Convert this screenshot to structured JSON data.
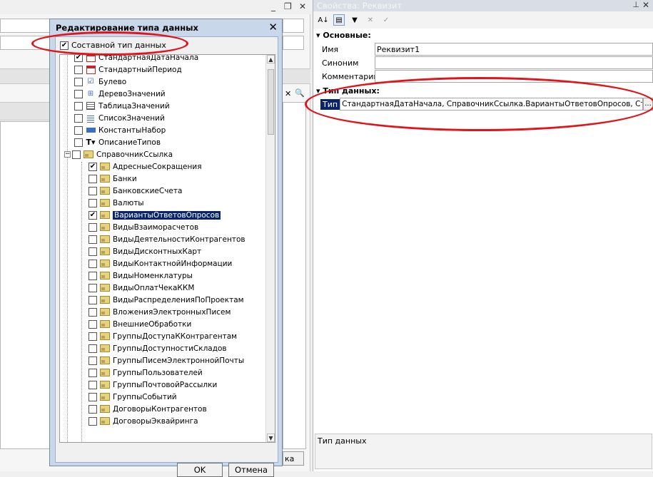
{
  "background_form": {
    "window_controls": [
      "_",
      "❐",
      "✕"
    ],
    "search_clear": "✕",
    "search_icon": "🔍",
    "partial_button_label": "ка"
  },
  "dialog": {
    "title": "Редактирование типа данных",
    "close_label": "✕",
    "composite_label": "Составной тип данных",
    "composite_checked": true,
    "ok_label": "OK",
    "cancel_label": "Отмена",
    "tree_items": [
      {
        "label": "СтандартнаяДатаНачала",
        "checked": true,
        "level": 0,
        "icon": "calendar-icon"
      },
      {
        "label": "СтандартныйПериод",
        "checked": false,
        "level": 0,
        "icon": "calendar-icon"
      },
      {
        "label": "Булево",
        "checked": false,
        "level": 0,
        "icon": "checkbox-icon"
      },
      {
        "label": "ДеревоЗначений",
        "checked": false,
        "level": 0,
        "icon": "tree-icon"
      },
      {
        "label": "ТаблицаЗначений",
        "checked": false,
        "level": 0,
        "icon": "table-icon"
      },
      {
        "label": "СписокЗначений",
        "checked": false,
        "level": 0,
        "icon": "list-icon"
      },
      {
        "label": "КонстантыНабор",
        "checked": false,
        "level": 0,
        "icon": "constants-icon"
      },
      {
        "label": "ОписаниеТипов",
        "checked": false,
        "level": 0,
        "icon": "type-description-icon"
      },
      {
        "label": "СправочникСсылка",
        "checked": false,
        "level": 0,
        "icon": "folder-icon",
        "expanded": true
      },
      {
        "label": "АдресныеСокращения",
        "checked": true,
        "level": 1,
        "icon": "folder-icon"
      },
      {
        "label": "Банки",
        "checked": false,
        "level": 1,
        "icon": "folder-icon"
      },
      {
        "label": "БанковскиеСчета",
        "checked": false,
        "level": 1,
        "icon": "folder-icon"
      },
      {
        "label": "Валюты",
        "checked": false,
        "level": 1,
        "icon": "folder-icon"
      },
      {
        "label": "ВариантыОтветовОпросов",
        "checked": true,
        "level": 1,
        "icon": "folder-icon",
        "selected": true
      },
      {
        "label": "ВидыВзаиморасчетов",
        "checked": false,
        "level": 1,
        "icon": "folder-icon"
      },
      {
        "label": "ВидыДеятельностиКонтрагентов",
        "checked": false,
        "level": 1,
        "icon": "folder-icon"
      },
      {
        "label": "ВидыДисконтныхКарт",
        "checked": false,
        "level": 1,
        "icon": "folder-icon"
      },
      {
        "label": "ВидыКонтактнойИнформации",
        "checked": false,
        "level": 1,
        "icon": "folder-icon"
      },
      {
        "label": "ВидыНоменклатуры",
        "checked": false,
        "level": 1,
        "icon": "folder-icon"
      },
      {
        "label": "ВидыОплатЧекаККМ",
        "checked": false,
        "level": 1,
        "icon": "folder-icon"
      },
      {
        "label": "ВидыРаспределенияПоПроектам",
        "checked": false,
        "level": 1,
        "icon": "folder-icon"
      },
      {
        "label": "ВложенияЭлектронныхПисем",
        "checked": false,
        "level": 1,
        "icon": "folder-icon"
      },
      {
        "label": "ВнешниеОбработки",
        "checked": false,
        "level": 1,
        "icon": "folder-icon"
      },
      {
        "label": "ГруппыДоступаККонтрагентам",
        "checked": false,
        "level": 1,
        "icon": "folder-icon"
      },
      {
        "label": "ГруппыДоступностиСкладов",
        "checked": false,
        "level": 1,
        "icon": "folder-icon"
      },
      {
        "label": "ГруппыПисемЭлектроннойПочты",
        "checked": false,
        "level": 1,
        "icon": "folder-icon"
      },
      {
        "label": "ГруппыПользователей",
        "checked": false,
        "level": 1,
        "icon": "folder-icon"
      },
      {
        "label": "ГруппыПочтовойРассылки",
        "checked": false,
        "level": 1,
        "icon": "folder-icon"
      },
      {
        "label": "ГруппыСобытий",
        "checked": false,
        "level": 1,
        "icon": "folder-icon"
      },
      {
        "label": "ДоговорыКонтрагентов",
        "checked": false,
        "level": 1,
        "icon": "folder-icon"
      },
      {
        "label": "ДоговорыЭквайринга",
        "checked": false,
        "level": 1,
        "icon": "folder-icon"
      }
    ]
  },
  "properties": {
    "title": "Свойства: Реквизит",
    "pin_label": "⊥",
    "close_label": "✕",
    "toolbar": [
      "sort-alpha-icon",
      "sort-category-icon",
      "filter-icon",
      "clear-icon",
      "apply-icon"
    ],
    "section_main": "Основные:",
    "name_label": "Имя",
    "name_value": "Реквизит1",
    "synonym_label": "Синоним",
    "synonym_value": "",
    "comment_label": "Комментарий",
    "comment_value": "",
    "section_type": "Тип данных:",
    "type_label": "Тип",
    "type_value": "СтандартнаяДатаНачала, СправочникСсылка.ВариантыОтветовОпросов, Строка, Д",
    "type_button": "...",
    "description_label": "Тип данных"
  },
  "annotation_color": "#e0141a"
}
